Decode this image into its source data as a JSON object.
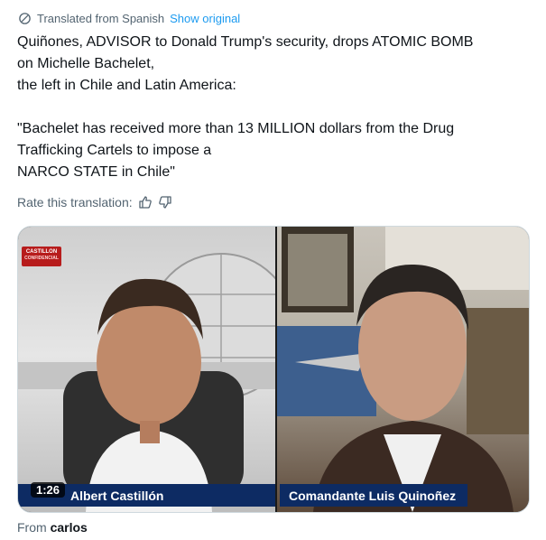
{
  "translation": {
    "label": "Translated from Spanish",
    "show_original": "Show original"
  },
  "tweet": {
    "line1": "Quiñones, ADVISOR to Donald Trump's security, drops ATOMIC BOMB",
    "line2": "on Michelle Bachelet,",
    "line3": "the left in Chile and Latin America:",
    "line4": "\"Bachelet has received more than 13 MILLION dollars from the Drug",
    "line5": "Trafficking Cartels to impose a",
    "line6": "NARCO STATE in Chile\""
  },
  "rate": {
    "label": "Rate this translation:",
    "up_icon": "thumbs-up-icon",
    "down_icon": "thumbs-down-icon"
  },
  "video": {
    "duration": "1:26",
    "logo_top": "CASTILLON",
    "logo_bottom": "CONFIDENCIAL",
    "left_name": "Albert Castillón",
    "right_name": "Comandante Luis Quinoñez"
  },
  "source": {
    "prefix": "From",
    "name": "carlos"
  },
  "colors": {
    "link": "#1d9bf0",
    "muted": "#536471",
    "text": "#0f1419",
    "name_tag": "#0d2b63"
  }
}
